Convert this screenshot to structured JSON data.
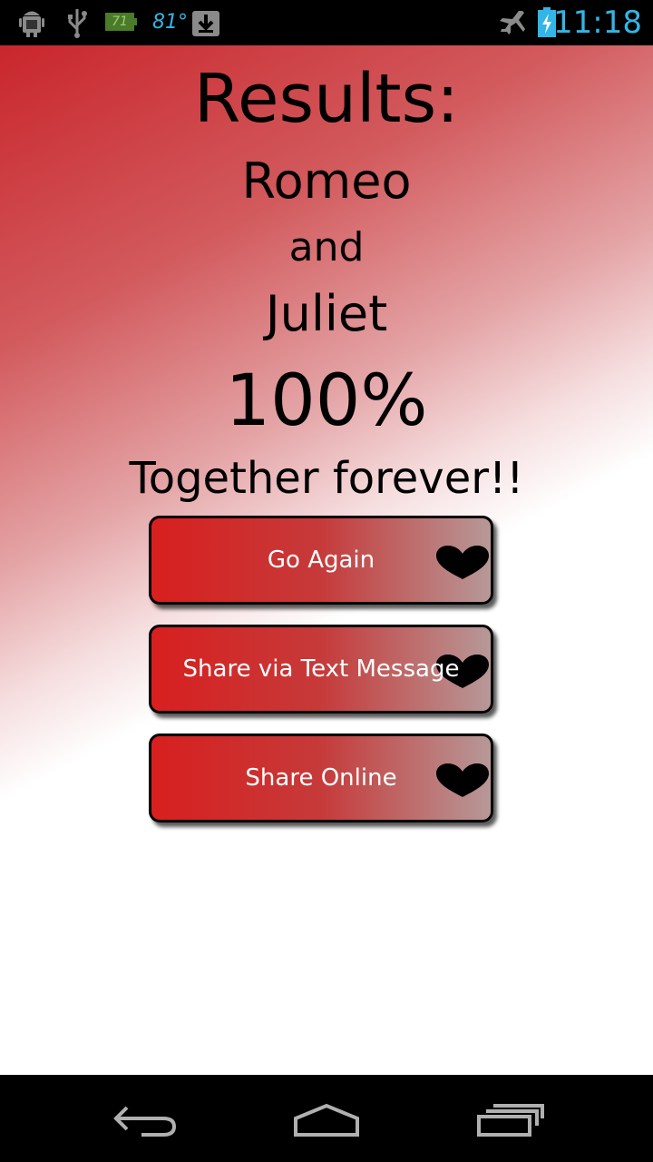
{
  "status_bar": {
    "icons": [
      "android-debug-icon",
      "usb-icon",
      "battery-app-icon",
      "temperature-icon",
      "download-icon",
      "airplane-mode-icon",
      "battery-charging-icon"
    ],
    "battery_app_value": "71",
    "temperature": "81°",
    "time": "11:18",
    "accent_color": "#33b5e5"
  },
  "results": {
    "title": "Results:",
    "name1": "Romeo",
    "conjunction": "and",
    "name2": "Juliet",
    "percentage": "100%",
    "verdict": "Together forever!!"
  },
  "buttons": {
    "go_again": "Go Again",
    "share_text": "Share via Text Message",
    "share_online": "Share Online",
    "icon": "heart-icon"
  },
  "nav_bar": {
    "icons": [
      "back-icon",
      "home-icon",
      "recent-apps-icon"
    ]
  },
  "colors": {
    "primary_red": "#d81f1f",
    "background_gradient_start": "#c9262c",
    "background": "#ffffff"
  }
}
